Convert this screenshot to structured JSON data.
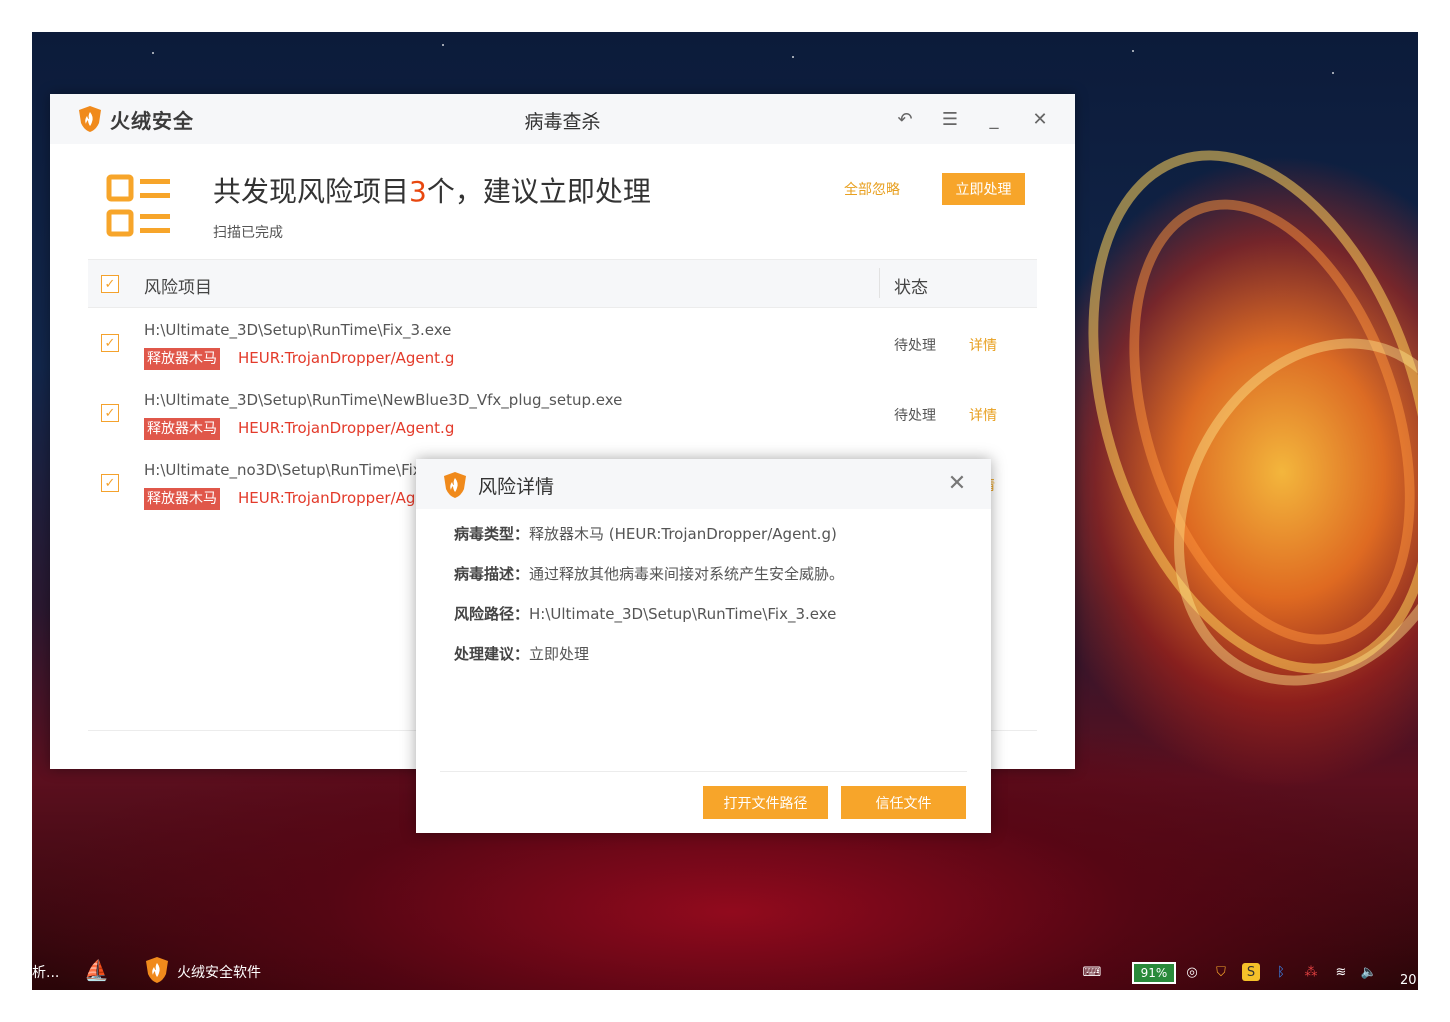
{
  "app": {
    "brand": "火绒安全",
    "window_title": "病毒查杀"
  },
  "summary": {
    "headline_prefix": "共发现风险项目",
    "count": "3",
    "headline_suffix": "个，建议立即处理",
    "subline": "扫描已完成",
    "ignore_all": "全部忽略",
    "handle_now": "立即处理"
  },
  "table": {
    "col_item": "风险项目",
    "col_status": "状态",
    "rows": [
      {
        "path": "H:\\Ultimate_3D\\Setup\\RunTime\\Fix_3.exe",
        "tag": "释放器木马",
        "threat": "HEUR:TrojanDropper/Agent.g",
        "status": "待处理",
        "detail": "详情"
      },
      {
        "path": "H:\\Ultimate_3D\\Setup\\RunTime\\NewBlue3D_Vfx_plug_setup.exe",
        "tag": "释放器木马",
        "threat": "HEUR:TrojanDropper/Agent.g",
        "status": "待处理",
        "detail": "详情"
      },
      {
        "path": "H:\\Ultimate_no3D\\Setup\\RunTime\\Fix",
        "tag": "释放器木马",
        "threat": "HEUR:TrojanDropper/Ag",
        "status": "",
        "detail": "情"
      }
    ]
  },
  "dialog": {
    "title": "风险详情",
    "rows": [
      {
        "key": "病毒类型：",
        "value": "释放器木马 (HEUR:TrojanDropper/Agent.g)"
      },
      {
        "key": "病毒描述：",
        "value": "通过释放其他病毒来间接对系统产生安全威胁。"
      },
      {
        "key": "风险路径：",
        "value": "H:\\Ultimate_3D\\Setup\\RunTime\\Fix_3.exe"
      },
      {
        "key": "处理建议：",
        "value": "立即处理"
      }
    ],
    "open_path": "打开文件路径",
    "trust_file": "信任文件"
  },
  "taskbar": {
    "left_text": "析...",
    "app_label": "火绒安全软件",
    "battery": "91%",
    "clock_fragment": "20"
  },
  "colors": {
    "accent": "#f7a52a",
    "danger": "#e33a2a",
    "tag_bg": "#e0574a"
  }
}
